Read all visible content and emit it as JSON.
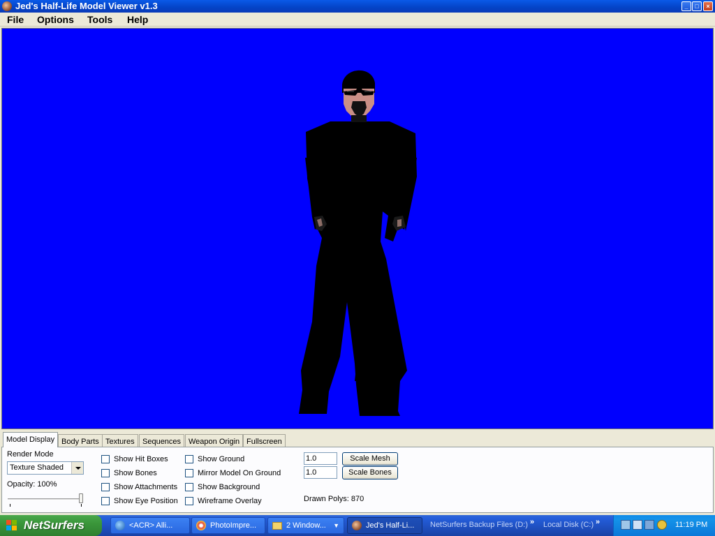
{
  "window": {
    "title": "Jed's Half-Life Model Viewer v1.3",
    "buttons": {
      "minimize": "_",
      "maximize": "□",
      "close": "×"
    }
  },
  "menu": [
    "File",
    "Options",
    "Tools",
    "Help"
  ],
  "viewport": {
    "background_color": "#0000fe",
    "model": "player character (black suit, sunglasses, goatee)"
  },
  "tabs": [
    "Model Display",
    "Body Parts",
    "Textures",
    "Sequences",
    "Weapon Origin",
    "Fullscreen"
  ],
  "active_tab": "Model Display",
  "model_display": {
    "render_mode_label": "Render Mode",
    "render_mode_value": "Texture Shaded",
    "opacity_label": "Opacity: 100%",
    "opacity_percent": 100,
    "checkboxes_col1": [
      "Show Hit Boxes",
      "Show Bones",
      "Show Attachments",
      "Show Eye Position"
    ],
    "checkboxes_col2": [
      "Show Ground",
      "Mirror Model On Ground",
      "Show Background",
      "Wireframe Overlay"
    ],
    "scale_mesh_value": "1.0",
    "scale_bones_value": "1.0",
    "scale_mesh_button": "Scale Mesh",
    "scale_bones_button": "Scale Bones",
    "drawn_polys": "Drawn Polys: 870"
  },
  "taskbar": {
    "start_label": "NetSurfers",
    "buttons": [
      {
        "label": "<ACR> Alli...",
        "icon": "browser-icon"
      },
      {
        "label": "PhotoImpre...",
        "icon": "photoimpression-icon"
      },
      {
        "label": "2 Window...",
        "icon": "folder-icon"
      },
      {
        "label": "Jed's Half-Li...",
        "icon": "hlmv-icon"
      }
    ],
    "quick_links": [
      "NetSurfers Backup Files (D:)",
      "Local Disk (C:)"
    ],
    "clock": "11:19 PM"
  }
}
